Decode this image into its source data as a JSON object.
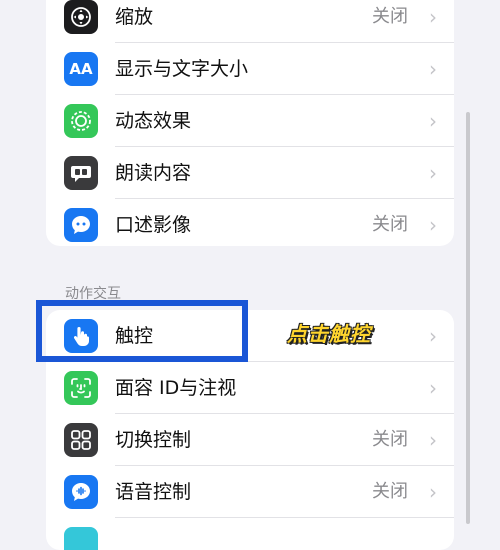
{
  "vision_section": {
    "items": [
      {
        "label": "缩放",
        "value": "关闭",
        "icon": "zoom-icon",
        "icon_bg": "#1c1c1e"
      },
      {
        "label": "显示与文字大小",
        "value": "",
        "icon": "text-size-icon",
        "icon_bg": "#1877f2"
      },
      {
        "label": "动态效果",
        "value": "",
        "icon": "motion-icon",
        "icon_bg": "#34c759"
      },
      {
        "label": "朗读内容",
        "value": "",
        "icon": "spoken-content-icon",
        "icon_bg": "#3a3a3c"
      },
      {
        "label": "口述影像",
        "value": "关闭",
        "icon": "audio-description-icon",
        "icon_bg": "#1877f2"
      }
    ]
  },
  "interaction_section": {
    "header": "动作交互",
    "items": [
      {
        "label": "触控",
        "value": "",
        "icon": "touch-icon",
        "icon_bg": "#1877f2"
      },
      {
        "label": "面容 ID与注视",
        "value": "",
        "icon": "face-id-icon",
        "icon_bg": "#34c759"
      },
      {
        "label": "切换控制",
        "value": "关闭",
        "icon": "switch-control-icon",
        "icon_bg": "#3a3a3c"
      },
      {
        "label": "语音控制",
        "value": "关闭",
        "icon": "voice-control-icon",
        "icon_bg": "#1877f2"
      }
    ]
  },
  "icon_glyphs": {
    "text_size": "AA"
  },
  "annotation": {
    "text": "点击触控",
    "highlight_color": "#1a56d6",
    "text_color": "#ffd52e"
  },
  "chevron": "›"
}
